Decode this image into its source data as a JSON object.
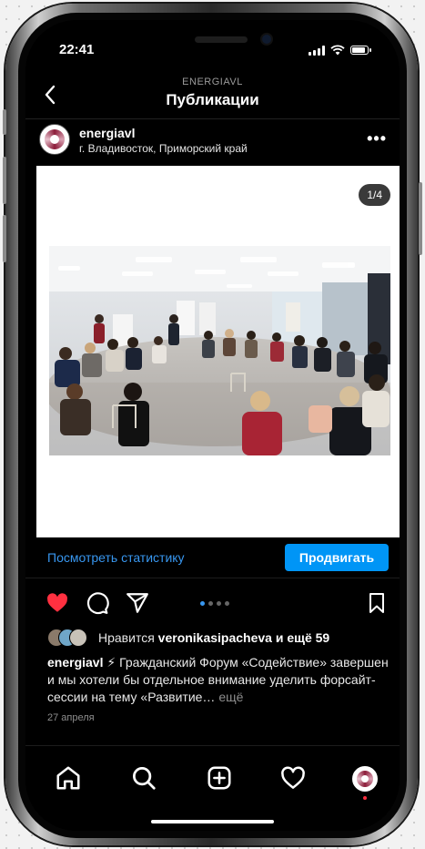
{
  "status_bar": {
    "time": "22:41"
  },
  "header": {
    "account": "ENERGIAVL",
    "title": "Публикации"
  },
  "post": {
    "username": "energiavl",
    "location": "г. Владивосток, Приморский край",
    "media_counter": "1/4",
    "stats_link": "Посмотреть статистику",
    "promote_button": "Продвигать",
    "carousel_dots": 4,
    "carousel_active": 1,
    "liked": true,
    "likes_prefix": "Нравится",
    "likes_user": "veronikasipacheva",
    "likes_suffix": "и ещё 59",
    "caption_user": "energiavl",
    "caption_text": "⚡ Гражданский Форум «Содействие» завершен и мы хотели бы отдельное внимание уделить форсайт-сессии на тему «Развитие…",
    "caption_more": "ещё",
    "date": "27 апреля"
  },
  "tabbar": {
    "items": [
      "home-icon",
      "search-icon",
      "add-post-icon",
      "activity-icon",
      "profile-avatar"
    ]
  },
  "colors": {
    "accent": "#0095f6",
    "link": "#3897f0",
    "like": "#ff3040",
    "background": "#000000"
  }
}
